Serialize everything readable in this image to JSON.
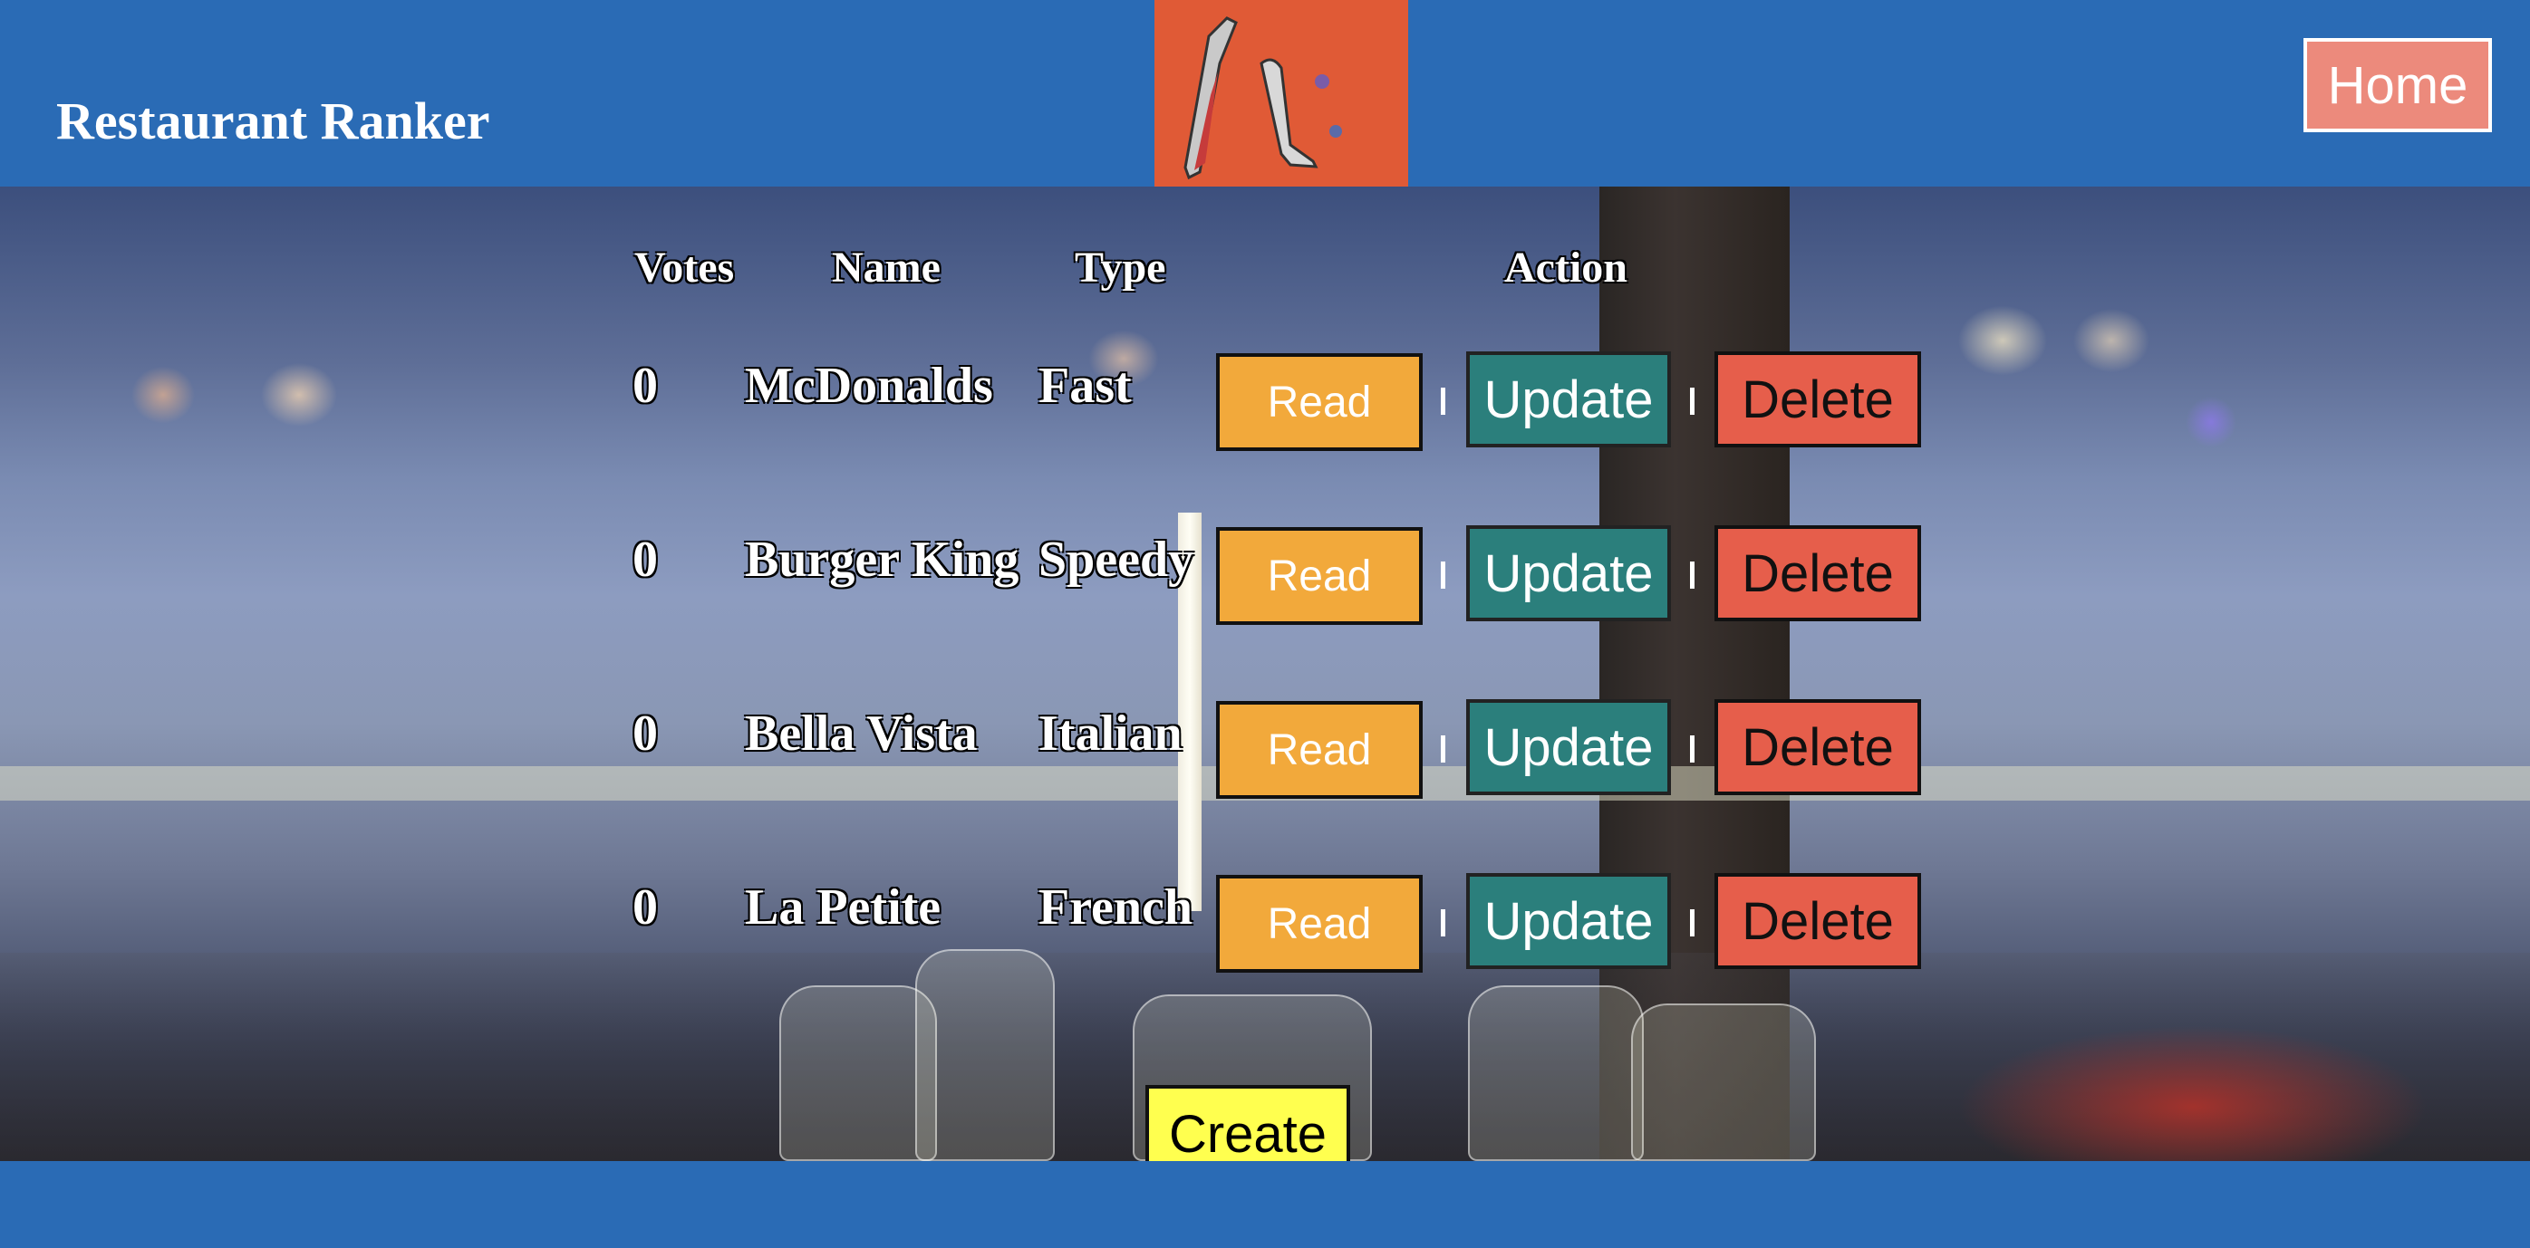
{
  "header": {
    "title": "Restaurant Ranker",
    "home_label": "Home",
    "logo_icon": "knife-fork-icon"
  },
  "table": {
    "headers": [
      "Votes",
      "Name",
      "Type",
      "Action"
    ],
    "rows": [
      {
        "votes": "0",
        "name": "McDonalds",
        "type": "Fast",
        "read": "Read",
        "update": "Update",
        "delete": "Delete"
      },
      {
        "votes": "0",
        "name": "Burger King",
        "type": "Speedy",
        "read": "Read",
        "update": "Update",
        "delete": "Delete"
      },
      {
        "votes": "0",
        "name": "Bella Vista",
        "type": "Italian",
        "read": "Read",
        "update": "Update",
        "delete": "Delete"
      },
      {
        "votes": "0",
        "name": "La Petite",
        "type": "French",
        "read": "Read",
        "update": "Update",
        "delete": "Delete"
      }
    ]
  },
  "create_label": "Create",
  "colors": {
    "header_bg": "#2a6bb5",
    "logo_bg": "#e05a36",
    "home_bg": "#ec8a7c",
    "read_bg": "#f2a93b",
    "update_bg": "#2b7f7c",
    "delete_bg": "#e65e4b",
    "create_bg": "#ffff4f"
  }
}
